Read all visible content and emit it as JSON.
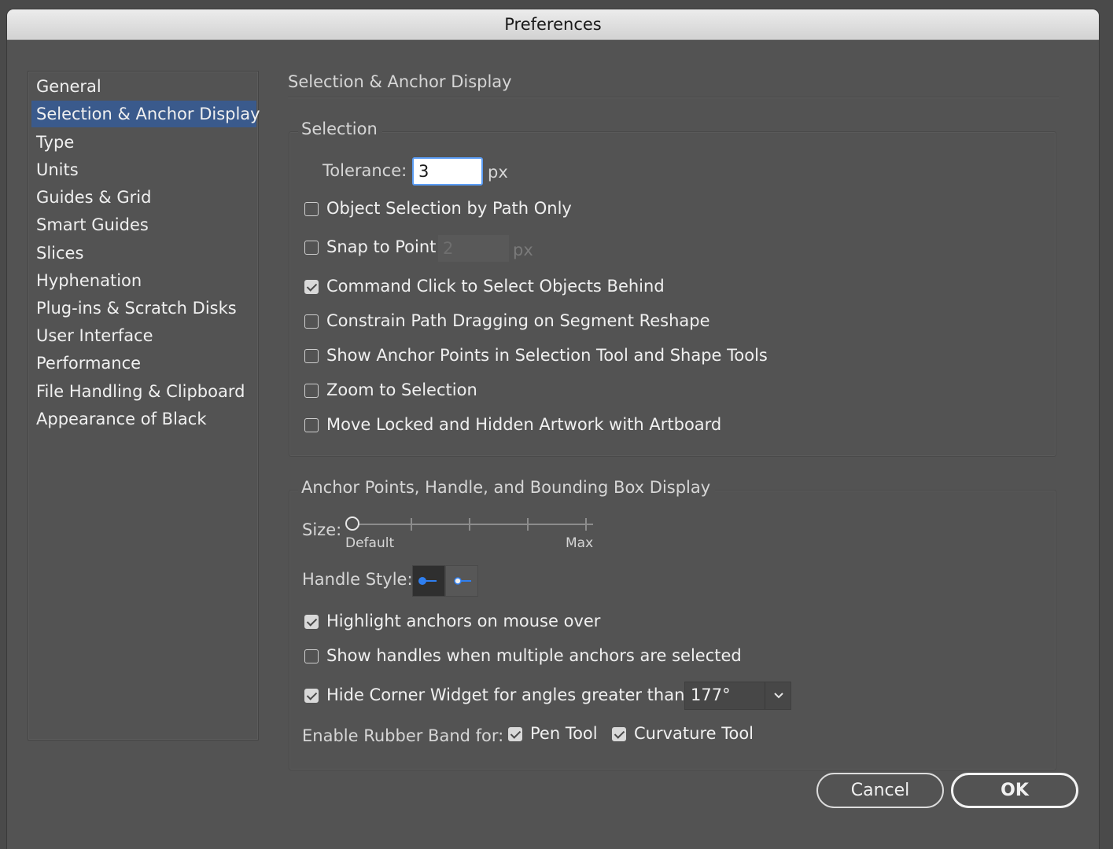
{
  "window": {
    "title": "Preferences"
  },
  "sidebar": {
    "items": [
      {
        "label": "General",
        "selected": false
      },
      {
        "label": "Selection & Anchor Display",
        "selected": true
      },
      {
        "label": "Type",
        "selected": false
      },
      {
        "label": "Units",
        "selected": false
      },
      {
        "label": "Guides & Grid",
        "selected": false
      },
      {
        "label": "Smart Guides",
        "selected": false
      },
      {
        "label": "Slices",
        "selected": false
      },
      {
        "label": "Hyphenation",
        "selected": false
      },
      {
        "label": "Plug-ins & Scratch Disks",
        "selected": false
      },
      {
        "label": "User Interface",
        "selected": false
      },
      {
        "label": "Performance",
        "selected": false
      },
      {
        "label": "File Handling & Clipboard",
        "selected": false
      },
      {
        "label": "Appearance of Black",
        "selected": false
      }
    ]
  },
  "pane": {
    "title": "Selection & Anchor Display"
  },
  "selection": {
    "title": "Selection",
    "tolerance_label": "Tolerance:",
    "tolerance_value": "3",
    "tolerance_unit": "px",
    "object_by_path": {
      "label": "Object Selection by Path Only",
      "checked": false
    },
    "snap_to_point": {
      "label": "Snap to Point",
      "checked": false,
      "value": "2",
      "unit": "px"
    },
    "command_click": {
      "label": "Command Click to Select Objects Behind",
      "checked": true
    },
    "constrain_path": {
      "label": "Constrain Path Dragging on Segment Reshape",
      "checked": false
    },
    "show_anchor_points": {
      "label": "Show Anchor Points in Selection Tool and Shape Tools",
      "checked": false
    },
    "zoom_to_selection": {
      "label": "Zoom to Selection",
      "checked": false
    },
    "move_locked": {
      "label": "Move Locked and Hidden Artwork with Artboard",
      "checked": false
    }
  },
  "anchor": {
    "title": "Anchor Points, Handle, and Bounding Box Display",
    "size_label": "Size:",
    "size_min_label": "Default",
    "size_max_label": "Max",
    "size_level": 0,
    "handle_style_label": "Handle Style:",
    "handle_style_selected": 0,
    "highlight_anchors": {
      "label": "Highlight anchors on mouse over",
      "checked": true
    },
    "show_handles": {
      "label": "Show handles when multiple anchors are selected",
      "checked": false
    },
    "hide_corner": {
      "label": "Hide Corner Widget for angles greater than:",
      "checked": true,
      "value": "177°"
    },
    "rubber_band_label": "Enable Rubber Band for:",
    "pen_tool": {
      "label": "Pen Tool",
      "checked": true
    },
    "curvature_tool": {
      "label": "Curvature Tool",
      "checked": true
    }
  },
  "buttons": {
    "cancel": "Cancel",
    "ok": "OK"
  },
  "colors": {
    "selection_highlight": "#3a5a8c",
    "handle_blue": "#2f7ff0",
    "focus_ring": "#5b9df5"
  },
  "icons": {
    "dropdown": "chevron-down-icon",
    "check": "checkmark-icon"
  }
}
